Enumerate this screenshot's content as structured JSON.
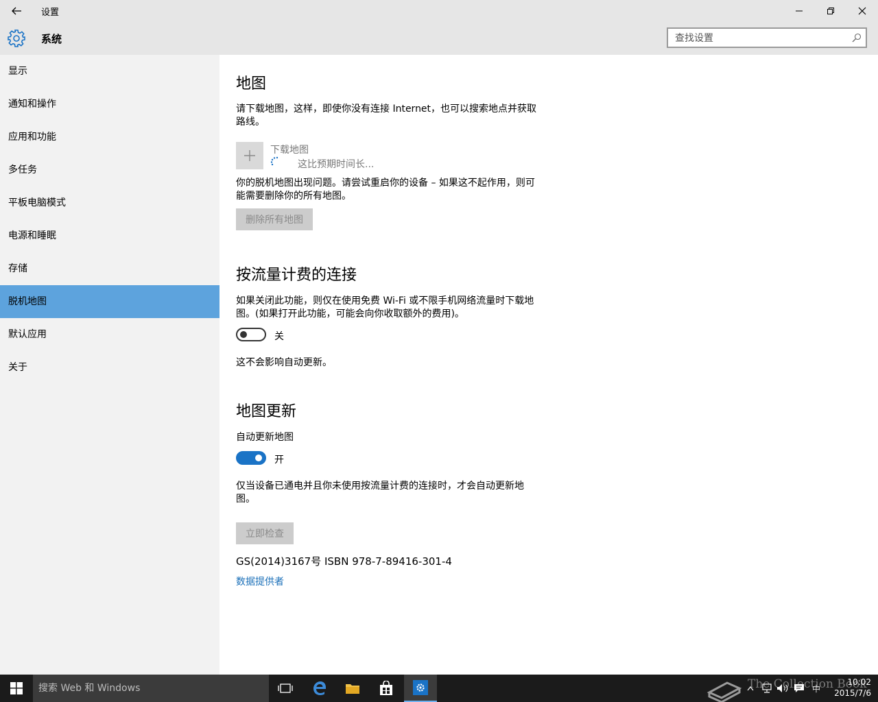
{
  "window": {
    "title": "设置",
    "back_icon": "back-arrow-icon",
    "minimize_icon": "minimize-icon",
    "restore_icon": "restore-icon",
    "close_icon": "close-icon"
  },
  "header": {
    "icon": "gear-icon",
    "title": "系统",
    "search_placeholder": "查找设置"
  },
  "sidebar": {
    "items": [
      {
        "label": "显示",
        "active": false
      },
      {
        "label": "通知和操作",
        "active": false
      },
      {
        "label": "应用和功能",
        "active": false
      },
      {
        "label": "多任务",
        "active": false
      },
      {
        "label": "平板电脑模式",
        "active": false
      },
      {
        "label": "电源和睡眠",
        "active": false
      },
      {
        "label": "存储",
        "active": false
      },
      {
        "label": "脱机地图",
        "active": true
      },
      {
        "label": "默认应用",
        "active": false
      },
      {
        "label": "关于",
        "active": false
      }
    ]
  },
  "maps": {
    "heading": "地图",
    "description": "请下载地图，这样，即使你没有连接 Internet，也可以搜索地点并获取路线。",
    "download_label": "下载地图",
    "download_status": "这比预期时间长...",
    "error_text": "你的脱机地图出现问题。请尝试重启你的设备 – 如果这不起作用，则可能需要删除你的所有地图。",
    "delete_button": "删除所有地图"
  },
  "metered": {
    "heading": "按流量计费的连接",
    "description": "如果关闭此功能，则仅在使用免费 Wi-Fi 或不限手机网络流量时下载地图。(如果打开此功能，可能会向你收取额外的费用)。",
    "toggle_state": "关",
    "note": "这不会影响自动更新。"
  },
  "updates": {
    "heading": "地图更新",
    "auto_update_label": "自动更新地图",
    "toggle_state": "开",
    "description": "仅当设备已通电并且你未使用按流量计费的连接时，才会自动更新地图。",
    "check_button": "立即检查",
    "license": "GS(2014)3167号 ISBN 978-7-89416-301-4",
    "provider_link": "数据提供者"
  },
  "taskbar": {
    "search_placeholder": "搜索 Web 和 Windows",
    "time": "10:02",
    "date": "2015/7/6",
    "ime": "中",
    "watermark": "The Collection Book"
  },
  "colors": {
    "accent": "#1a73c6",
    "sidebar_active": "#5da3dd",
    "chrome": "#e6e6e6",
    "sidebar_bg": "#f2f2f2",
    "taskbar_bg": "#1b1b1b"
  }
}
